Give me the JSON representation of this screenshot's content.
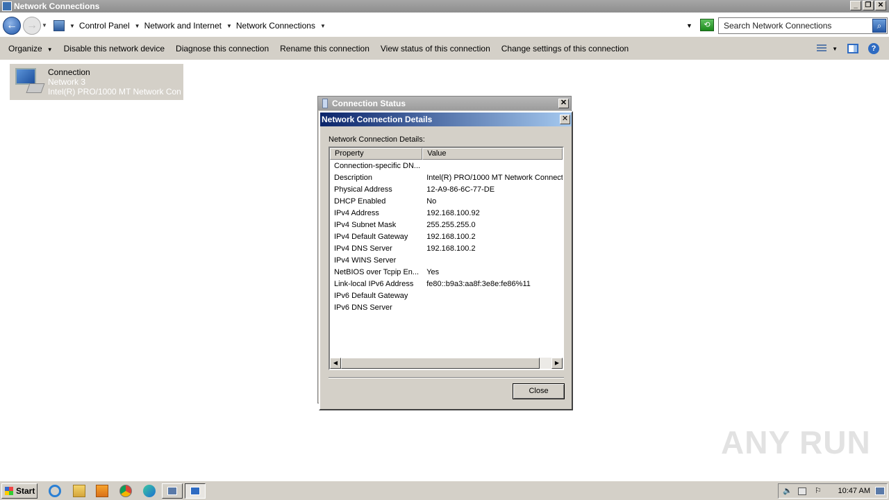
{
  "window": {
    "title": "Network Connections",
    "controls": [
      "_",
      "❐",
      "✕"
    ]
  },
  "address": {
    "crumbs": [
      "Control Panel",
      "Network and Internet",
      "Network Connections"
    ],
    "search_placeholder": "Search Network Connections"
  },
  "toolbar": {
    "organize": "Organize",
    "disable": "Disable this network device",
    "diagnose": "Diagnose this connection",
    "rename": "Rename this connection",
    "view_status": "View status of this connection",
    "change_settings": "Change settings of this connection"
  },
  "connection_item": {
    "name": "Connection",
    "network": "Network  3",
    "adapter": "Intel(R) PRO/1000 MT Network Conn..."
  },
  "status_window": {
    "title": "Connection Status"
  },
  "details_dialog": {
    "title": "Network Connection Details",
    "label": "Network Connection Details:",
    "columns": [
      "Property",
      "Value"
    ],
    "rows": [
      {
        "property": "Connection-specific DN...",
        "value": ""
      },
      {
        "property": "Description",
        "value": "Intel(R) PRO/1000 MT Network Connect"
      },
      {
        "property": "Physical Address",
        "value": "12-A9-86-6C-77-DE"
      },
      {
        "property": "DHCP Enabled",
        "value": "No"
      },
      {
        "property": "IPv4 Address",
        "value": "192.168.100.92"
      },
      {
        "property": "IPv4 Subnet Mask",
        "value": "255.255.255.0"
      },
      {
        "property": "IPv4 Default Gateway",
        "value": "192.168.100.2"
      },
      {
        "property": "IPv4 DNS Server",
        "value": "192.168.100.2"
      },
      {
        "property": "IPv4 WINS Server",
        "value": ""
      },
      {
        "property": "NetBIOS over Tcpip En...",
        "value": "Yes"
      },
      {
        "property": "Link-local IPv6 Address",
        "value": "fe80::b9a3:aa8f:3e8e:fe86%11"
      },
      {
        "property": "IPv6 Default Gateway",
        "value": ""
      },
      {
        "property": "IPv6 DNS Server",
        "value": ""
      }
    ],
    "close_label": "Close"
  },
  "watermark": "ANY RUN",
  "taskbar": {
    "start_label": "Start",
    "clock": "10:47 AM"
  }
}
